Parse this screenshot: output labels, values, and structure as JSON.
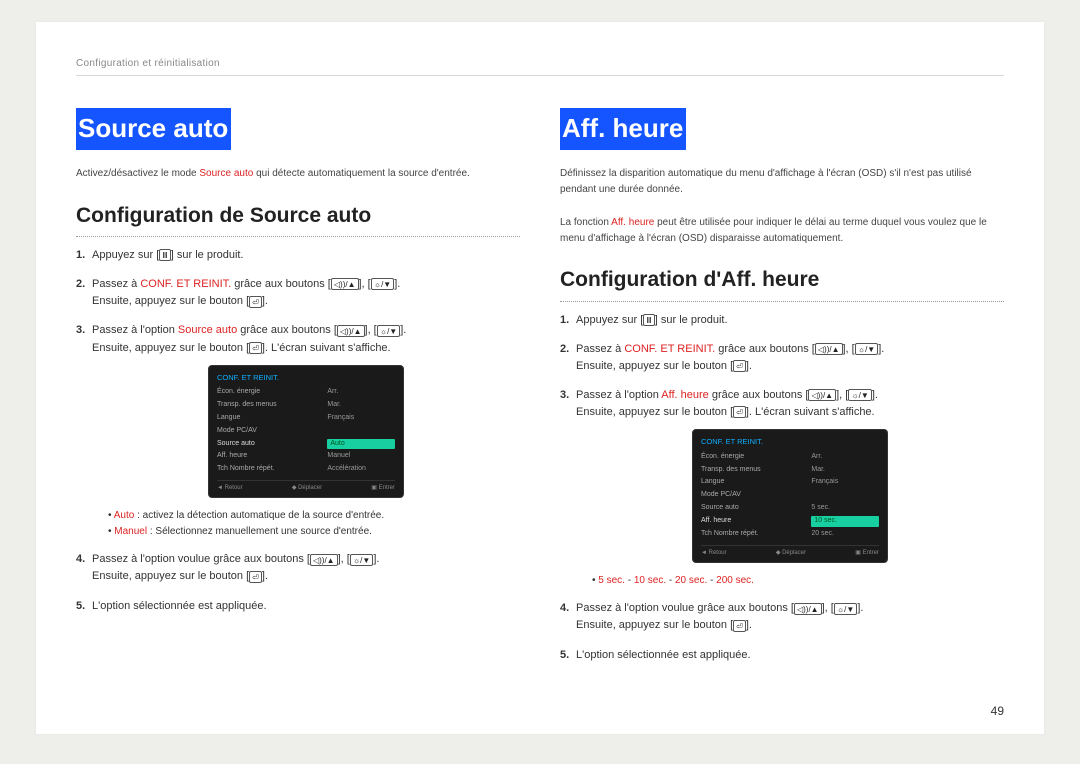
{
  "breadcrumb": "Configuration et réinitialisation",
  "page_number": "49",
  "icons": {
    "menu": "Ⅲ",
    "vol_up": "◁))/▲",
    "bright_down": "☼/▼",
    "enter": "⏎"
  },
  "osd": {
    "title": "CONF. ET REINIT.",
    "items": {
      "econ": "Écon. énergie",
      "econ_v": "Arr.",
      "transp": "Transp. des menus",
      "transp_v": "Mar.",
      "langue": "Langue",
      "langue_v": "Français",
      "mode": "Mode PC/AV",
      "source": "Source auto",
      "source_v": "Auto",
      "aff": "Aff. heure",
      "aff_v": "20 sec.",
      "tch": "Tch Nombre répét.",
      "tch_v": "Accélération",
      "slot_manuel": "Manuel"
    },
    "foot": {
      "retour": "Retour",
      "deplacer": "Déplacer",
      "entrer": "Entrer"
    },
    "aff_opts": {
      "a": "5 sec.",
      "b": "10 sec.",
      "c": "20 sec.",
      "d": "200 sec."
    }
  },
  "left": {
    "h1": "Source auto",
    "intro_a": "Activez/désactivez le mode ",
    "intro_b": "Source auto",
    "intro_c": " qui détecte automatiquement la source d'entrée.",
    "h2": "Configuration de Source auto",
    "s1a": "Appuyez sur [",
    "s1b": "] sur le produit.",
    "s2a": "Passez à ",
    "s2b": "CONF. ET REINIT.",
    "s2c": " grâce aux boutons [",
    "s2d": "], [",
    "s2e": "].",
    "s2f": "Ensuite, appuyez sur le bouton [",
    "s2g": "].",
    "s3a": "Passez à l'option ",
    "s3b": "Source auto",
    "s3c": " grâce aux boutons [",
    "s3d": "], [",
    "s3e": "].",
    "s3f": "Ensuite, appuyez sur le bouton [",
    "s3g": "]. L'écran suivant s'affiche.",
    "bul1a": "Auto",
    "bul1b": " : activez la détection automatique de la source d'entrée.",
    "bul2a": "Manuel",
    "bul2b": " : Sélectionnez manuellement une source d'entrée.",
    "s4a": "Passez à l'option voulue grâce aux boutons [",
    "s4b": "], [",
    "s4c": "].",
    "s4d": "Ensuite, appuyez sur le bouton [",
    "s4e": "].",
    "s5": "L'option sélectionnée est appliquée."
  },
  "right": {
    "h1": "Aff. heure",
    "intro": "Définissez la disparition automatique du menu d'affichage à l'écran (OSD) s'il n'est pas utilisé pendant une durée donnée.",
    "intro2a": "La fonction ",
    "intro2b": "Aff. heure",
    "intro2c": " peut être utilisée pour indiquer le délai au terme duquel vous voulez que le menu d'affichage à l'écran (OSD) disparaisse automatiquement.",
    "h2": "Configuration d'Aff. heure",
    "s1a": "Appuyez sur [",
    "s1b": "] sur le produit.",
    "s2a": "Passez à ",
    "s2b": "CONF. ET REINIT.",
    "s2c": " grâce aux boutons [",
    "s2d": "], [",
    "s2e": "].",
    "s2f": "Ensuite, appuyez sur le bouton [",
    "s2g": "].",
    "s3a": "Passez à l'option ",
    "s3b": "Aff. heure",
    "s3c": " grâce aux boutons [",
    "s3d": "], [",
    "s3e": "].",
    "s3f": "Ensuite, appuyez sur le bouton [",
    "s3g": "]. L'écran suivant s'affiche.",
    "bulsep": " - ",
    "s4a": "Passez à l'option voulue grâce aux boutons [",
    "s4b": "], [",
    "s4c": "].",
    "s4d": "Ensuite, appuyez sur le bouton [",
    "s4e": "].",
    "s5": "L'option sélectionnée est appliquée."
  }
}
